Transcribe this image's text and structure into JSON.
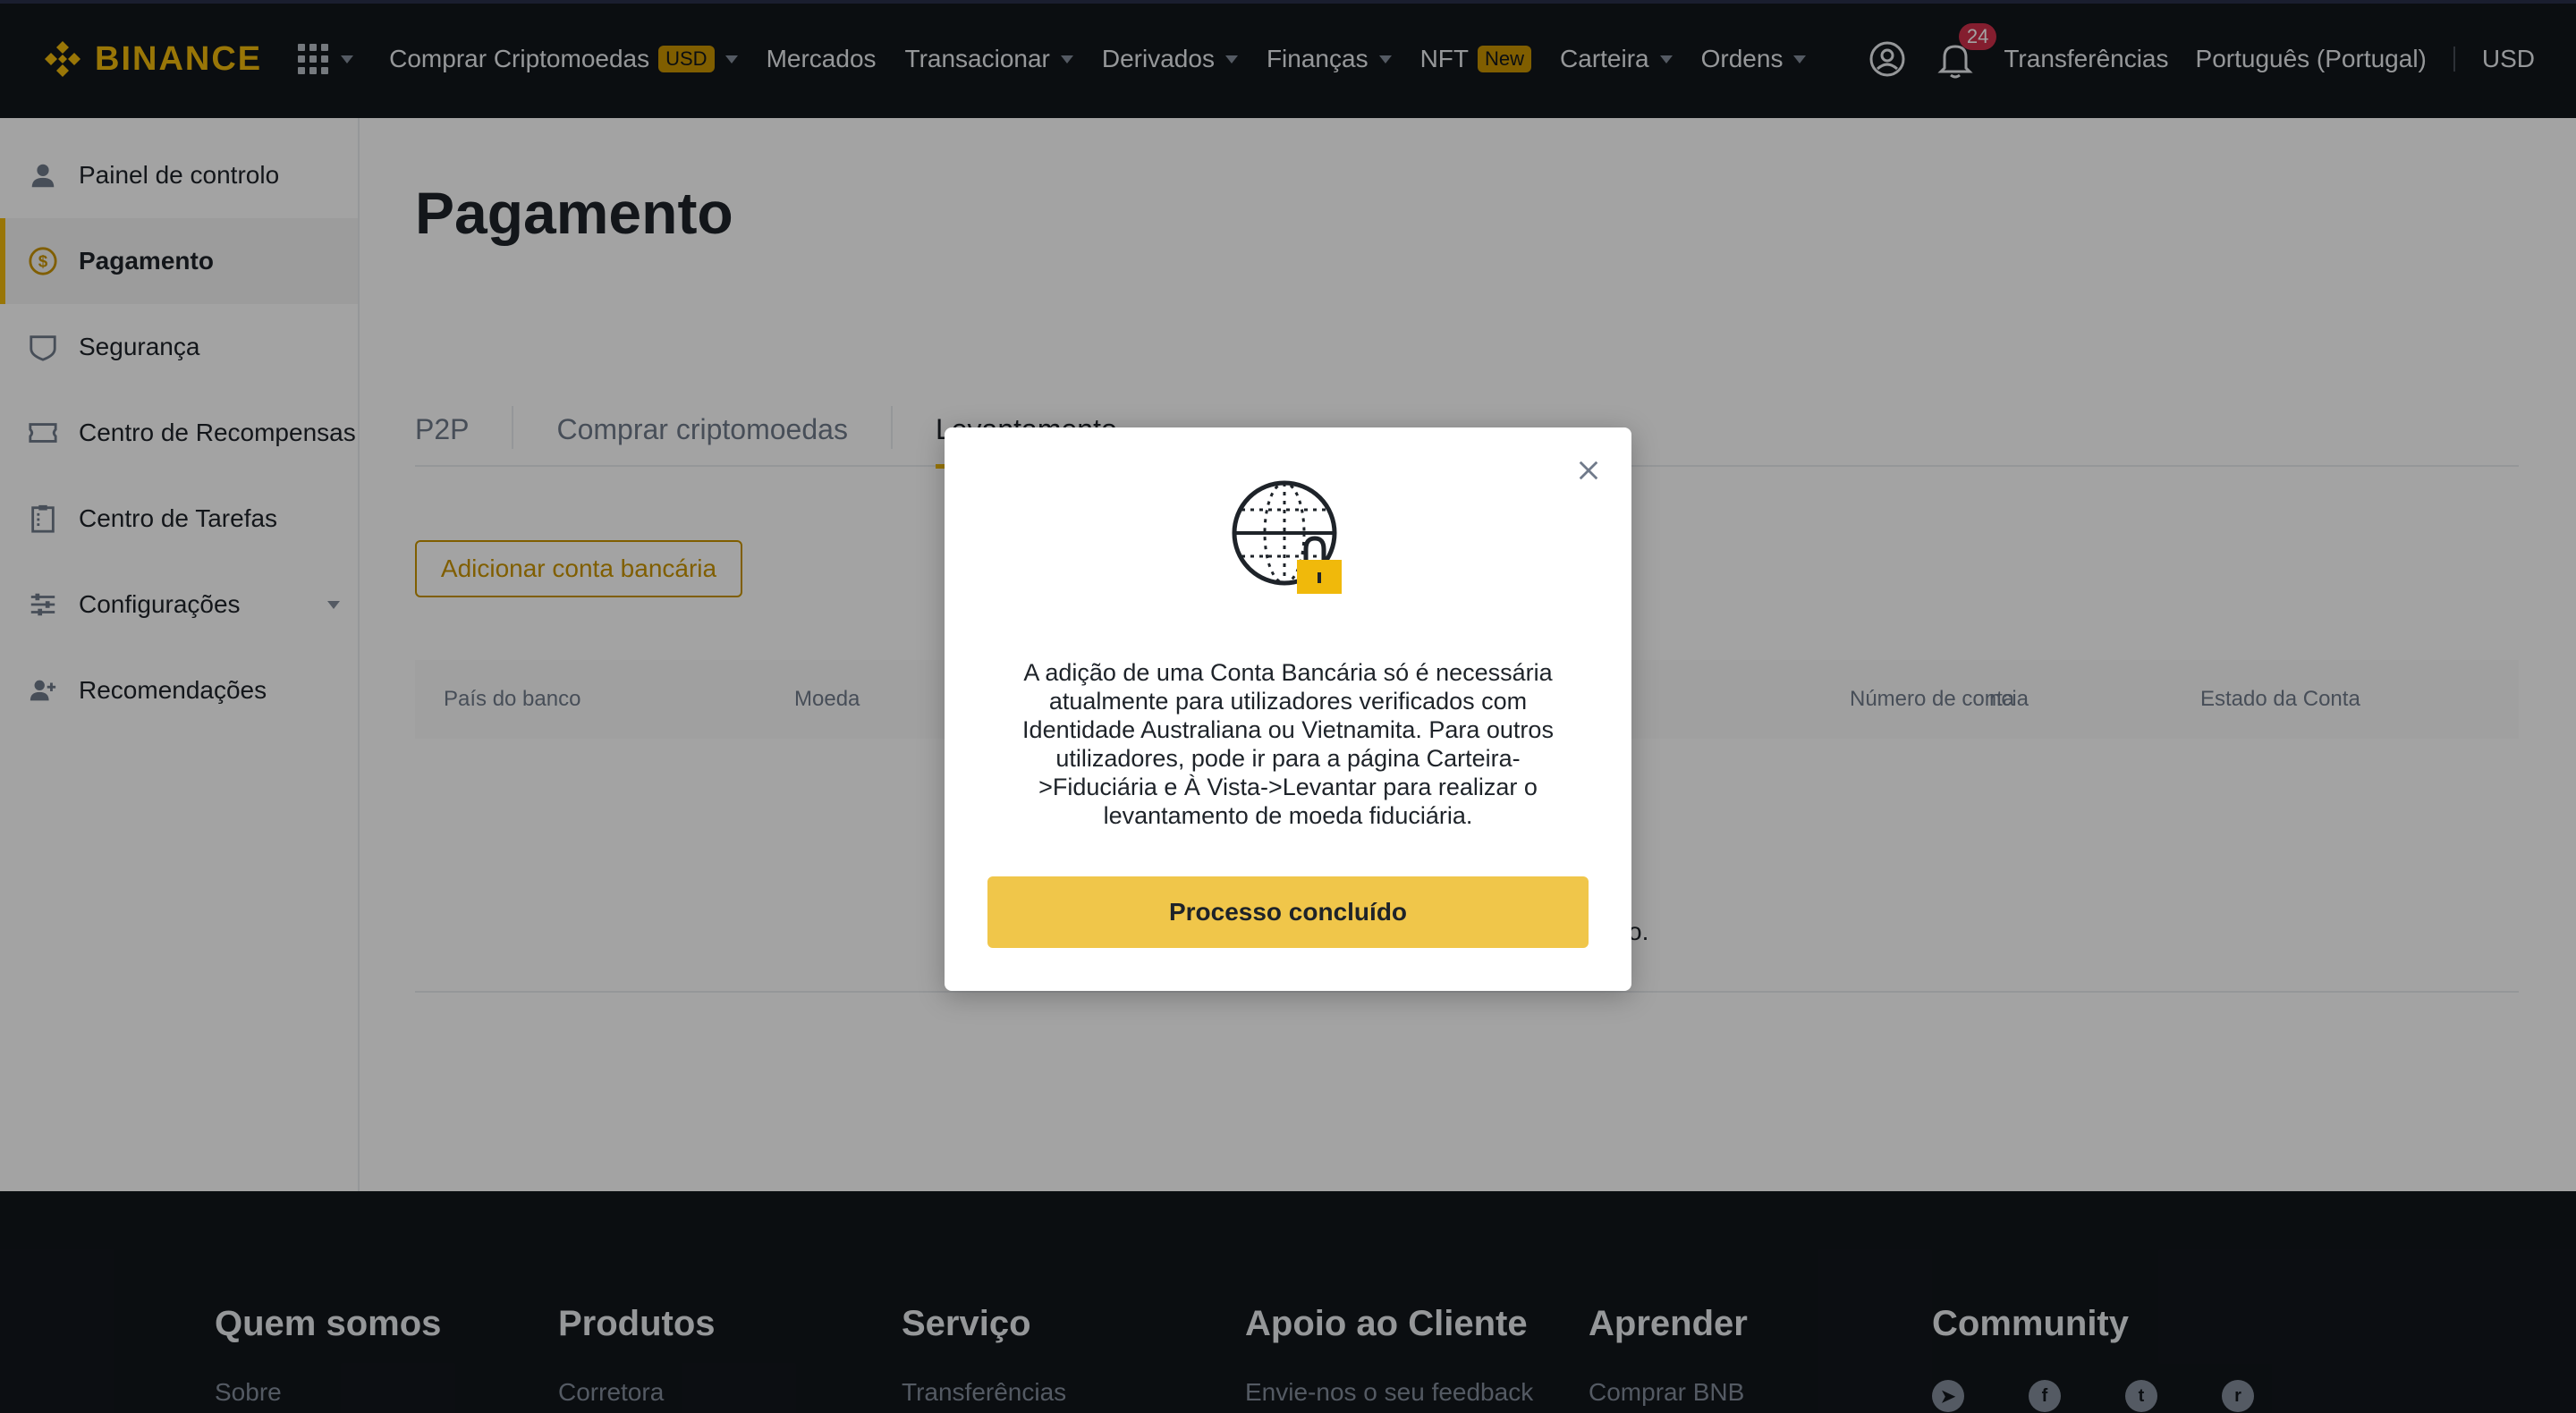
{
  "topnav": {
    "logo_text": "BINANCE",
    "items": [
      {
        "label": "Comprar Criptomoedas",
        "badge": "USD",
        "has_caret": true
      },
      {
        "label": "Mercados",
        "has_caret": false
      },
      {
        "label": "Transacionar",
        "has_caret": true
      },
      {
        "label": "Derivados",
        "has_caret": true
      },
      {
        "label": "Finanças",
        "has_caret": true
      },
      {
        "label": "NFT",
        "badge": "New",
        "has_caret": false
      },
      {
        "label": "Carteira",
        "has_caret": true
      },
      {
        "label": "Ordens",
        "has_caret": true
      }
    ],
    "notifications_count": "24",
    "transfers_label": "Transferências",
    "language_label": "Português (Portugal)",
    "currency_label": "USD"
  },
  "sidebar": {
    "items": [
      {
        "label": "Painel de controlo",
        "icon": "user-icon"
      },
      {
        "label": "Pagamento",
        "icon": "dollar-icon",
        "active": true
      },
      {
        "label": "Segurança",
        "icon": "shield-icon"
      },
      {
        "label": "Centro de Recompensas",
        "icon": "ticket-icon"
      },
      {
        "label": "Centro de Tarefas",
        "icon": "clipboard-icon"
      },
      {
        "label": "Configurações",
        "icon": "sliders-icon",
        "has_caret": true
      },
      {
        "label": "Recomendações",
        "icon": "add-user-icon"
      }
    ]
  },
  "main": {
    "title": "Pagamento",
    "tabs": [
      {
        "label": "P2P"
      },
      {
        "label": "Comprar criptomoedas"
      },
      {
        "label": "Levantamento",
        "active": true
      }
    ],
    "add_bank_label": "Adicionar conta bancária",
    "table_headers": [
      "País do banco",
      "Moeda",
      "ncia",
      "Número de conta",
      "Estado da Conta"
    ],
    "empty_text_fragment": "o."
  },
  "footer": {
    "columns": [
      {
        "heading": "Quem somos",
        "link": "Sobre"
      },
      {
        "heading": "Produtos",
        "link": "Corretora"
      },
      {
        "heading": "Serviço",
        "link": "Transferências"
      },
      {
        "heading": "Apoio ao Cliente",
        "link": "Envie-nos o seu feedback"
      },
      {
        "heading": "Aprender",
        "link": "Comprar BNB"
      },
      {
        "heading": "Community",
        "link": ""
      }
    ],
    "social_icons": [
      "telegram-icon",
      "facebook-icon",
      "twitter-icon",
      "reddit-icon"
    ]
  },
  "modal": {
    "message": "A adição de uma Conta Bancária só é necessária atualmente para utilizadores verificados com Identidade Australiana ou Vietnamita. Para outros utilizadores, pode ir para a página Carteira->Fiduciária e À Vista->Levantar para realizar o levantamento de moeda fiduciária.",
    "button_label": "Processo concluído",
    "illustration": "globe-lock-icon"
  },
  "colors": {
    "brand_yellow": "#f0b90b",
    "nav_bg": "#12161c",
    "button_yellow": "#f0c64a",
    "notif_red": "#cf304a"
  }
}
